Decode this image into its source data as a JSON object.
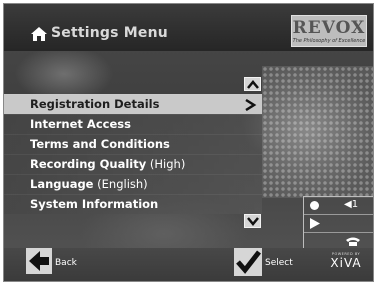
{
  "header": {
    "title": "Settings Menu",
    "brand": {
      "name": "REVOX",
      "tagline": "The Philosophy of Excellence"
    }
  },
  "menu": {
    "items": [
      {
        "label": "Registration Details",
        "suffix": "",
        "selected": true
      },
      {
        "label": "Internet Access",
        "suffix": "",
        "selected": false
      },
      {
        "label": "Terms and Conditions",
        "suffix": "",
        "selected": false
      },
      {
        "label": "Recording Quality",
        "suffix": " (High)",
        "selected": false
      },
      {
        "label": "Language",
        "suffix": " (English)",
        "selected": false
      },
      {
        "label": "System Information",
        "suffix": "",
        "selected": false
      }
    ]
  },
  "status": {
    "volume": "◀1"
  },
  "footer": {
    "back_label": "Back",
    "select_label": "Select",
    "powered_by": "POWERED BY",
    "xiva": "XiVA"
  },
  "colors": {
    "selected_row": "#c9c9c9",
    "button_face": "#d6d6d6"
  }
}
